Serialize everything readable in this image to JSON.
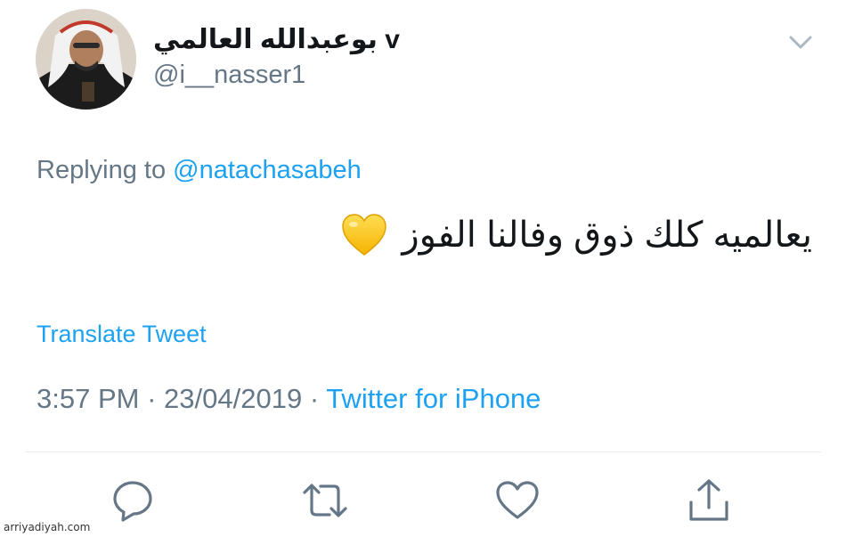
{
  "author": {
    "display_name": "بوعبدالله العالمي v",
    "handle": "@i__nasser1"
  },
  "reply": {
    "prefix": "Replying to",
    "mention": "@natachasabeh"
  },
  "tweet": {
    "text": "يعالميه كلك ذوق وفالنا الفوز",
    "emoji": "yellow-heart-emoji"
  },
  "translate_label": "Translate Tweet",
  "meta": {
    "time": "3:57 PM",
    "separator": "·",
    "date": "23/04/2019",
    "source": "Twitter for iPhone"
  },
  "actions": [
    {
      "name": "reply",
      "icon": "reply-icon"
    },
    {
      "name": "retweet",
      "icon": "retweet-icon"
    },
    {
      "name": "like",
      "icon": "heart-icon"
    },
    {
      "name": "share",
      "icon": "share-icon"
    }
  ],
  "watermark": "arriyadiyah.com",
  "colors": {
    "text": "#14171a",
    "secondary": "#657786",
    "link": "#1da1f2",
    "divider": "#e6ecf0"
  }
}
